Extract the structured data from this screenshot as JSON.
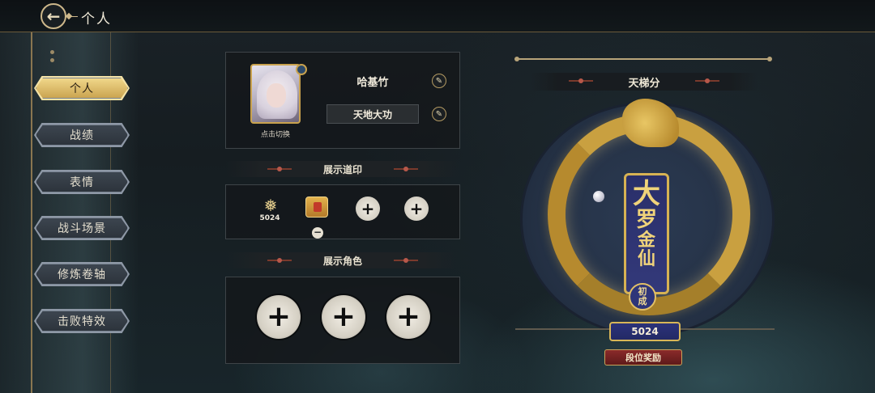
{
  "header": {
    "title": "个人",
    "back_icon": "back-arrow-icon"
  },
  "sidebar": {
    "items": [
      {
        "label": "个人",
        "active": true
      },
      {
        "label": "战绩",
        "active": false
      },
      {
        "label": "表情",
        "active": false
      },
      {
        "label": "战斗场景",
        "active": false
      },
      {
        "label": "修炼卷轴",
        "active": false
      },
      {
        "label": "击败特效",
        "active": false
      }
    ]
  },
  "profile": {
    "avatar_caption": "点击切换",
    "name": "哈基竹",
    "title": "天地大功"
  },
  "seals": {
    "header": "展示道印",
    "items": [
      {
        "icon": "dragon-seal-icon",
        "value": "5024"
      },
      {
        "icon": "book-seal-icon"
      },
      {
        "icon": "plus-icon"
      },
      {
        "icon": "plus-icon"
      }
    ]
  },
  "roles": {
    "header": "展示角色"
  },
  "rank": {
    "header": "天梯分",
    "scroll_chars": [
      "大",
      "罗",
      "金",
      "仙"
    ],
    "sub_rank": [
      "初",
      "成"
    ],
    "score": "5024",
    "reward_label": "段位奖励"
  },
  "colors": {
    "accent_gold": "#c9a24e",
    "active_tab": "#f2d98c",
    "scroll_blue": "#2a2f6a",
    "reward_red": "#8a2a2a"
  }
}
